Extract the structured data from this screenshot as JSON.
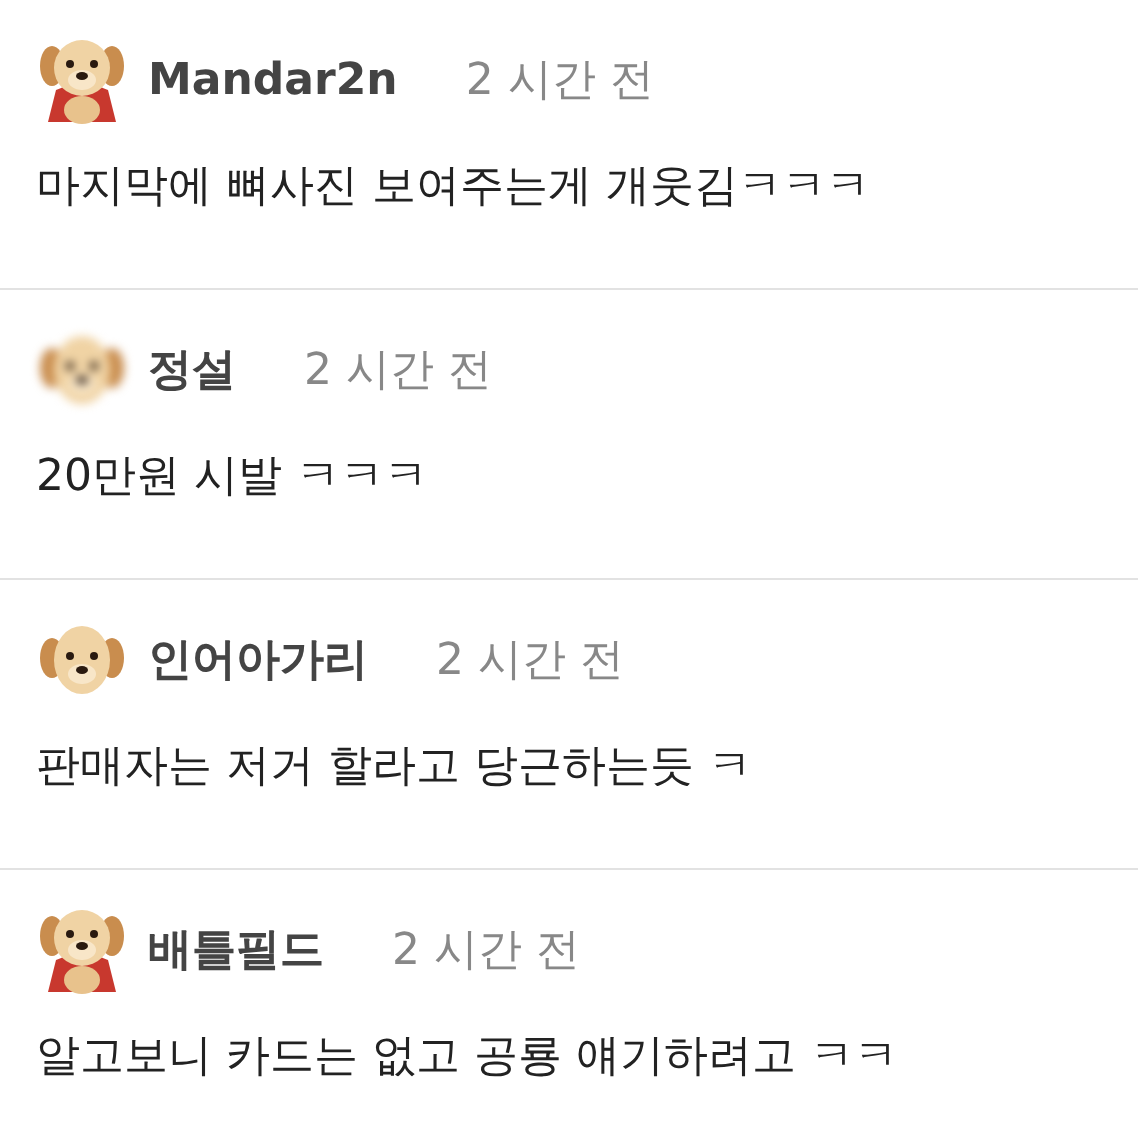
{
  "comments": [
    {
      "author": "Mandar2n",
      "time": "2 시간 전",
      "text": "마지막에 뼈사진 보여주는게 개웃김ㅋㅋㅋ",
      "avatar": {
        "kind": "caped",
        "blurred": false
      }
    },
    {
      "author": "정설",
      "time": "2 시간 전",
      "text": "20만원 시발 ㅋㅋㅋ",
      "avatar": {
        "kind": "head",
        "blurred": true
      }
    },
    {
      "author": "인어아가리",
      "time": "2 시간 전",
      "text": "판매자는 저거 할라고 당근하는듯 ㅋ",
      "avatar": {
        "kind": "head",
        "blurred": false
      }
    },
    {
      "author": "배틀필드",
      "time": "2 시간 전",
      "text": "알고보니 카드는 없고 공룡 얘기하려고 ㅋㅋ",
      "avatar": {
        "kind": "caped",
        "blurred": false
      }
    }
  ]
}
